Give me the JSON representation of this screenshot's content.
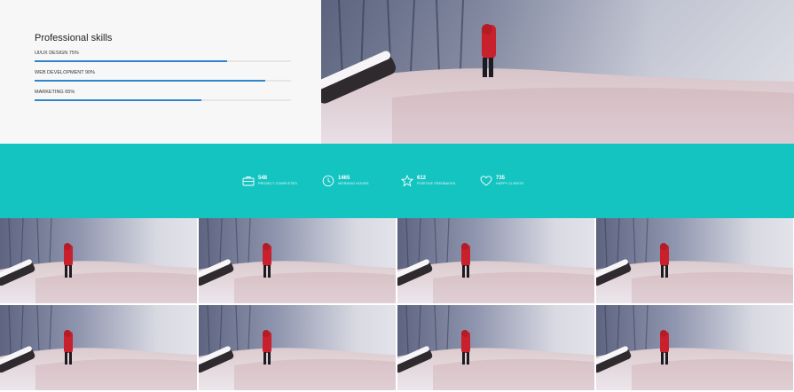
{
  "skills": {
    "title": "Professional skills",
    "items": [
      {
        "label": "UI/UX DESIGN 75%",
        "percent": 75
      },
      {
        "label": "WEB DEVELOPMENT 90%",
        "percent": 90
      },
      {
        "label": "MARKETING 65%",
        "percent": 65
      }
    ]
  },
  "hero_image": {
    "alt": "",
    "icon": "snow-photo"
  },
  "stats": {
    "background": "#14c4c1",
    "items": [
      {
        "icon": "briefcase-icon",
        "number": "548",
        "caption": "PROJECT COMPLETED"
      },
      {
        "icon": "clock-icon",
        "number": "1465",
        "caption": "WORKING HOURS"
      },
      {
        "icon": "star-icon",
        "number": "612",
        "caption": "POSITIVE FEEDBACKS"
      },
      {
        "icon": "heart-icon",
        "number": "735",
        "caption": "HAPPY CLIENTS"
      }
    ]
  },
  "gallery": {
    "count": 8,
    "tile_icon": "snow-photo"
  },
  "colors": {
    "accent_bar": "#2d86cf",
    "stats_band": "#14c4c1",
    "panel_bg": "#f7f7f7"
  }
}
